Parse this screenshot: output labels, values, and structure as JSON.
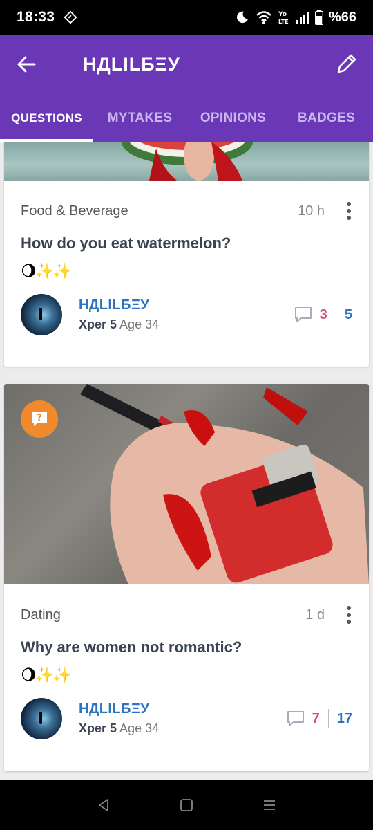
{
  "status": {
    "time": "18:33",
    "battery": "%66",
    "network": "Yo LTE"
  },
  "appbar": {
    "title": "НДLILБΞУ"
  },
  "tabs": [
    {
      "label": "QUESTIONS",
      "active": true
    },
    {
      "label": "MYTAKES",
      "active": false
    },
    {
      "label": "OPINIONS",
      "active": false
    },
    {
      "label": "BADGES",
      "active": false
    }
  ],
  "posts": [
    {
      "category": "Food & Beverage",
      "time_ago": "10 h",
      "title": "How do you eat watermelon?",
      "emoji": "🌖✨✨",
      "author": {
        "name": "НДLILБΞУ",
        "level": "Xper 5",
        "age": "Age 34"
      },
      "comments": "3",
      "votes": "5"
    },
    {
      "category": "Dating",
      "time_ago": "1 d",
      "title": "Why are women not romantic?",
      "emoji": "🌖✨✨",
      "author": {
        "name": "НДLILБΞУ",
        "level": "Xper 5",
        "age": "Age 34"
      },
      "comments": "7",
      "votes": "17"
    }
  ],
  "colors": {
    "appbar": "#6a38b6",
    "comments": "#d24f86",
    "votes": "#2d73bf",
    "badge": "#f08a2c"
  }
}
